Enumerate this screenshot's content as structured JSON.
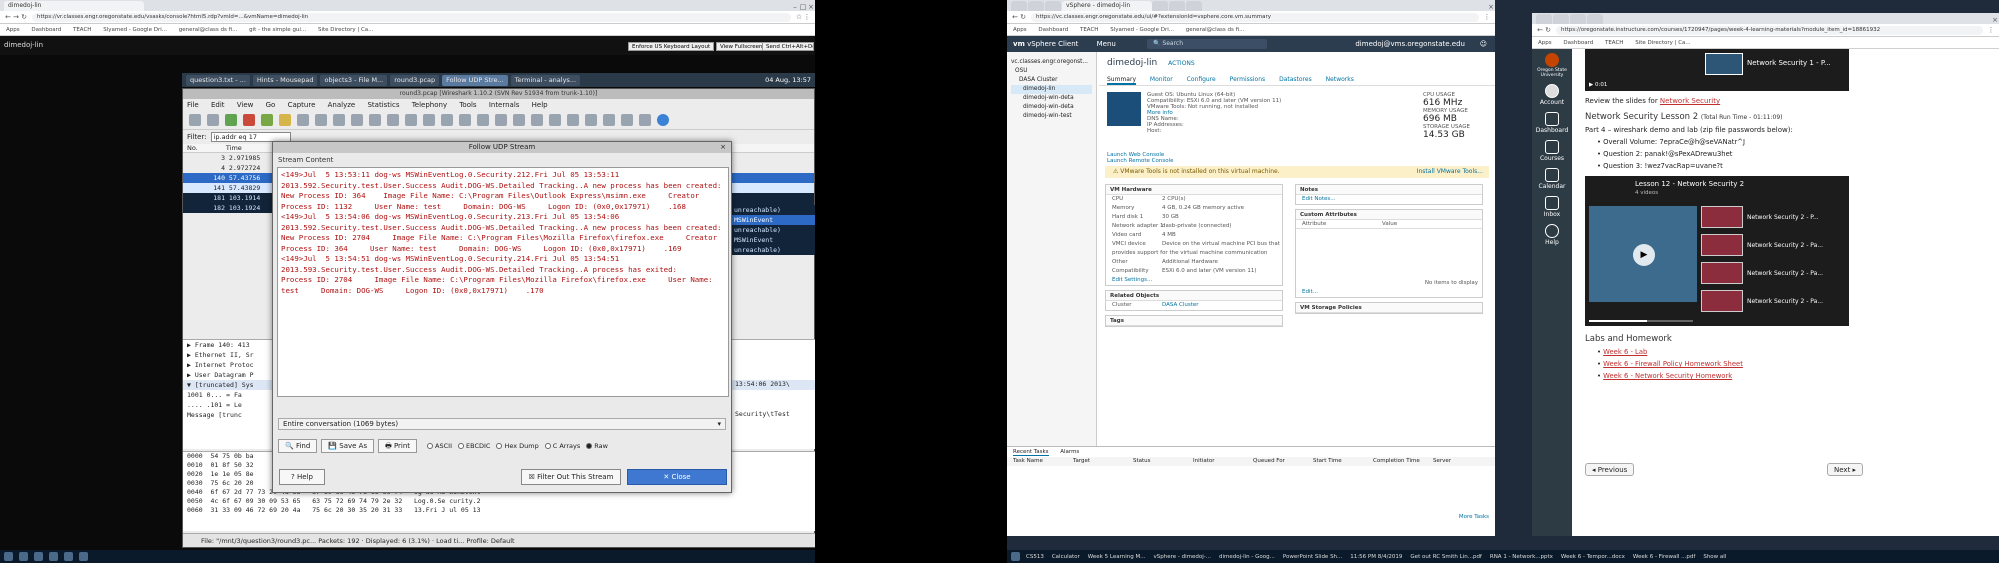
{
  "left_browser": {
    "tab_title": "dimedoj-lin",
    "url": "https://vr.classes.engr.oregonstate.edu/vsasks/console?html5.rdp?vmId=...&vmName=dimedoj-lin",
    "bookmarks": [
      "Apps",
      "Dashboard",
      "TEACH",
      "Slyamed - Google Dri...",
      "general@class ds fi...",
      "git - the simple gui...",
      "Site Directory | Ca..."
    ]
  },
  "remote_bar": {
    "host": "dimedoj-lin",
    "buttons": [
      "Enforce US Keyboard Layout",
      "View Fullscreen",
      "Send Ctrl+Alt+Delete"
    ]
  },
  "guest_taskbar": {
    "items": [
      "question3.txt - ...",
      "Hints - Mousepad",
      "objects3 - File M...",
      "round3.pcap",
      "Follow UDP Stre...",
      "Terminal - analys..."
    ],
    "active_index": 4,
    "clock": "04 Aug, 13:57"
  },
  "wireshark": {
    "title": "round3.pcap  [Wireshark 1.10.2 (SVN Rev 51934 from trunk-1.10)]",
    "menu": [
      "File",
      "Edit",
      "View",
      "Go",
      "Capture",
      "Analyze",
      "Statistics",
      "Telephony",
      "Tools",
      "Internals",
      "Help"
    ],
    "filter_label": "Filter:",
    "filter_value": "ip.addr eq 17",
    "col_no": "No.",
    "col_time": "Time",
    "packets": [
      {
        "no": "3",
        "time": "2.971985"
      },
      {
        "no": "4",
        "time": "2.972724"
      },
      {
        "no": "140",
        "time": "57.43756"
      },
      {
        "no": "141",
        "time": "57.43829"
      },
      {
        "no": "181",
        "time": "103.1914"
      },
      {
        "no": "182",
        "time": "103.1924"
      }
    ],
    "right_info": [
      "",
      "unreachable)",
      "MSWinEvent",
      "unreachable)",
      "MSWinEvent",
      "unreachable)"
    ],
    "details": [
      "▶ Frame 140: 413",
      "▶ Ethernet II, Sr",
      "▶ Internet Protoc",
      "▶ User Datagram P",
      "▼ [truncated] Sys",
      "    1001 0... = Fa",
      "    .... .101 = Le",
      "    Message [trunc"
    ],
    "detail_right": [
      "13:54:06 2013\\",
      "Security\\tTest"
    ],
    "hex": [
      "0000  54 75 0b ba",
      "0010  01 8f 50 32",
      "0020  1e 1e 05 8e",
      "0030  75 6c 20 20",
      "0040  6f 67 2d 77 73 20 4d 53   57 69 6e 45 76 65 6e 74   og-ws MS WinEvent",
      "0050  4c 6f 67 09 30 09 53 65   63 75 72 69 74 79 2e 32   Log.0.Se curity.2",
      "0060  31 33 09 46 72 69 20 4a   75 6c 20 30 35 20 31 33   13.Fri J ul 05 13"
    ],
    "status": "File: \"/mnt/3/question3/round3.pc...   Packets: 192 · Displayed: 6 (3.1%) · Load ti...     Profile: Default"
  },
  "follow_dialog": {
    "title": "Follow UDP Stream",
    "section_label": "Stream Content",
    "stream_text": "<149>Jul  5 13:53:11 dog-ws MSWinEventLog.0.Security.212.Fri Jul 05 13:53:11 2013.592.Security.test.User.Success Audit.DOG-WS.Detailed Tracking..A new process has been created:     New Process ID: 364    Image File Name: C:\\Program Files\\Outlook Express\\msimn.exe     Creator Process ID: 1132     User Name: test     Domain: DOG-WS     Logon ID: (0x0,0x17971)    .168\n<149>Jul  5 13:54:06 dog-ws MSWinEventLog.0.Security.213.Fri Jul 05 13:54:06 2013.592.Security.test.User.Success Audit.DOG-WS.Detailed Tracking..A new process has been created:     New Process ID: 2704     Image File Name: C:\\Program Files\\Mozilla Firefox\\firefox.exe     Creator Process ID: 364     User Name: test     Domain: DOG-WS     Logon ID: (0x0,0x17971)    .169\n<149>Jul  5 13:54:51 dog-ws MSWinEventLog.0.Security.214.Fri Jul 05 13:54:51 2013.593.Security.test.User.Success Audit.DOG-WS.Detailed Tracking..A process has exited:     Process ID: 2704     Image File Name: C:\\Program Files\\Mozilla Firefox\\firefox.exe     User Name: test     Domain: DOG-WS     Logon ID: (0x0,0x17971)    .170",
    "conversation": "Entire conversation (1069 bytes)",
    "buttons": {
      "find": "Find",
      "save_as": "Save As",
      "print": "Print"
    },
    "radios": [
      "ASCII",
      "EBCDIC",
      "Hex Dump",
      "C Arrays",
      "Raw"
    ],
    "help": "Help",
    "filter_out": "Filter Out This Stream",
    "close": "Close"
  },
  "host_taskbar_left": {
    "items": [
      "File",
      "Edit",
      "Chrome",
      "Term",
      "Mail"
    ]
  },
  "vsphere": {
    "tab_title": "vSphere - dimedoj-lin",
    "url": "https://vc.classes.engr.oregonstate.edu/ui/#?extensionId=vsphere.core.vm.summary",
    "brand": "vSphere Client",
    "menu": "Menu",
    "search_placeholder": "Search",
    "user": "dimedoj@vms.oregonstate.edu",
    "vm_name": "dimedoj-lin",
    "actions": "ACTIONS",
    "tabs": [
      "Summary",
      "Monitor",
      "Configure",
      "Permissions",
      "Datastores",
      "Networks"
    ],
    "tree": [
      "vc.classes.engr.oregonst...",
      "OSU",
      "DASA Cluster",
      "dimedoj-lin",
      "dimedoj-win-deta",
      "dimedoj-win-deta",
      "dimedoj-win-test"
    ],
    "guest_os": "Guest OS:",
    "guest_os_val": "Ubuntu Linux (64-bit)",
    "compat": "Compatibility:",
    "compat_val": "ESXi 6.0 and later (VM version 11)",
    "vmware_tools": "VMware Tools:",
    "vmware_tools_val": "Not running, not installed",
    "more_info": "More info",
    "dns": "DNS Name:",
    "ip": "IP Addresses:",
    "host": "Host:",
    "cpu_label": "CPU USAGE",
    "cpu_val": "616 MHz",
    "mem_label": "MEMORY USAGE",
    "mem_val": "696 MB",
    "storage_label": "STORAGE USAGE",
    "storage_val": "14.53 GB",
    "launch_web": "Launch Web Console",
    "launch_remote": "Launch Remote Console",
    "warning": "VMware Tools is not installed on this virtual machine.",
    "install_tools": "Install VMware Tools...",
    "hardware_title": "VM Hardware",
    "hardware": [
      [
        "CPU",
        "2 CPU(s)"
      ],
      [
        "Memory",
        "4 GB, 0.24 GB memory active"
      ],
      [
        "Hard disk 1",
        "30 GB"
      ],
      [
        "Network adapter 1",
        "dasb-private (connected)"
      ],
      [
        "Video card",
        "4 MB"
      ],
      [
        "VMCI device",
        "Device on the virtual machine PCI bus that provides support for the virtual machine communication interface"
      ],
      [
        "Other",
        "Additional Hardware"
      ],
      [
        "Compatibility",
        "ESXi 6.0 and later (VM version 11)"
      ]
    ],
    "edit_settings": "Edit Settings...",
    "notes_title": "Notes",
    "edit_notes": "Edit Notes...",
    "custom_title": "Custom Attributes",
    "attr_col": "Attribute",
    "value_col": "Value",
    "no_items": "No items to display",
    "edit": "Edit...",
    "storage_policies": "VM Storage Policies",
    "related": "Related Objects",
    "cluster_label": "Cluster",
    "cluster_val": "DASA Cluster",
    "tags": "Tags",
    "recent_tasks": "Recent Tasks",
    "alarms": "Alarms",
    "task_cols": [
      "Task Name",
      "Target",
      "Status",
      "Initiator",
      "Queued For",
      "Start Time",
      "Completion Time",
      "Server"
    ],
    "more_tasks": "More Tasks"
  },
  "host_taskbar_mid": {
    "items": [
      "CS513",
      "Calculator",
      "Week 5 Learning M...",
      "vSphere - dimedoj-...",
      "dimedoj-lin - Goog...",
      "PowerPoint Slide Sh..."
    ],
    "time": "11:56 PM",
    "date": "8/4/2019"
  },
  "canvas": {
    "url": "https://oregonstate.instructure.com/courses/1720947/pages/week-4-learning-materials?module_item_id=18861932",
    "university": "Oregon State University",
    "nav": [
      "Account",
      "Dashboard",
      "Courses",
      "Calendar",
      "Inbox",
      "Help"
    ],
    "video1_title": "Network Security 1 - P...",
    "video1_time": "0:01",
    "review_prefix": "Review the slides for ",
    "review_link": "Network Security",
    "lesson_heading": "Network Security Lesson 2",
    "lesson_runtime": "(Total Run Time - 01:11:09)",
    "part_intro": "Part 4 – wireshark demo and lab (zip file passwords below):",
    "bullets": [
      "Overall Volume: 7epraCe@h@seVANatr^J",
      "Question 2: panak!@sPexADrewu3het",
      "Question 3: !wez7vacRap=uvane?t"
    ],
    "playlist_title": "Lesson 12 - Network Security 2",
    "playlist_count": "4 videos",
    "playlist_items": [
      "Network Security 2 - P...",
      "Network Security 2 - Pa...",
      "Network Security 2 - Pa...",
      "Network Security 2 - Pa..."
    ],
    "labs_heading": "Labs and Homework",
    "labs": [
      "Week 6 - Lab",
      "Week 6 - Firewall Policy Homework Sheet",
      "Week 6 - Network Security Homework"
    ],
    "prev": "◂ Previous",
    "next": "Next ▸"
  },
  "host_taskbar_right": {
    "items": [
      "Get out RC Smith Lin...pdf",
      "RNA 1 - Network...pptx",
      "Week 6 - Tempor...docx",
      "Week 6 - Firewall ...pdf"
    ],
    "show_all": "Show all"
  }
}
